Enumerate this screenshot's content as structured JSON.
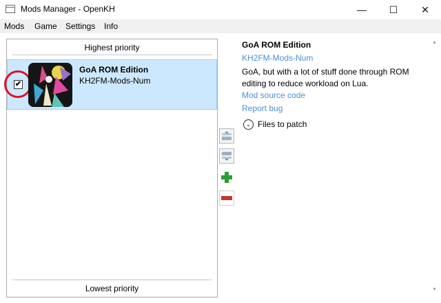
{
  "window": {
    "title": "Mods Manager - OpenKH",
    "minimize_glyph": "—",
    "maximize_glyph": "☐",
    "close_glyph": "✕"
  },
  "menu": {
    "items": [
      "Mods",
      "Game",
      "Settings",
      "Info"
    ]
  },
  "mod_list": {
    "top_label": "Highest priority",
    "bottom_label": "Lowest priority",
    "items": [
      {
        "name": "GoA ROM Edition",
        "author": "KH2FM-Mods-Num",
        "enabled": true,
        "check_glyph": "✔"
      }
    ]
  },
  "side_buttons": [
    {
      "icon": "move-up-icon"
    },
    {
      "icon": "move-down-icon"
    },
    {
      "icon": "add-icon",
      "color": "#2e9e2e"
    },
    {
      "icon": "remove-icon",
      "color": "#c0392b"
    }
  ],
  "details": {
    "name": "GoA ROM Edition",
    "author": "KH2FM-Mods-Num",
    "description": "GoA, but with a lot of stuff done through ROM editing to reduce workload on Lua.",
    "source_link": "Mod source code",
    "report_link": "Report bug",
    "files_label": "Files to patch",
    "files_glyph": "⌄"
  },
  "colors": {
    "selection_bg": "#cce8ff",
    "link": "#4a90d9",
    "highlight_circle": "#e0102a"
  }
}
